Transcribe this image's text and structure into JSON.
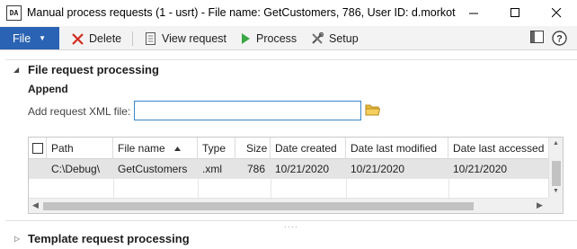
{
  "window": {
    "app_icon_text": "DA",
    "title": "Manual process requests (1 - usrt) - File name: GetCustomers, 786, User ID: d.morkot"
  },
  "toolbar": {
    "file_label": "File",
    "delete_label": "Delete",
    "view_request_label": "View request",
    "process_label": "Process",
    "setup_label": "Setup"
  },
  "file_request": {
    "title": "File request processing",
    "append_label": "Append",
    "xml_file_label": "Add request XML file:",
    "xml_file_value": ""
  },
  "grid": {
    "columns": [
      "Path",
      "File name",
      "Type",
      "Size",
      "Date created",
      "Date last modified",
      "Date last accessed"
    ],
    "rows": [
      {
        "path": "C:\\Debug\\",
        "file_name": "GetCustomers",
        "type": ".xml",
        "size": "786",
        "date_created": "10/21/2020",
        "date_modified": "10/21/2020",
        "date_accessed": "10/21/2020"
      }
    ]
  },
  "template_request": {
    "title": "Template request processing"
  },
  "colors": {
    "accent": "#2a63b3",
    "selected_row": "#e4e4e4",
    "input_border": "#3a86c8"
  }
}
